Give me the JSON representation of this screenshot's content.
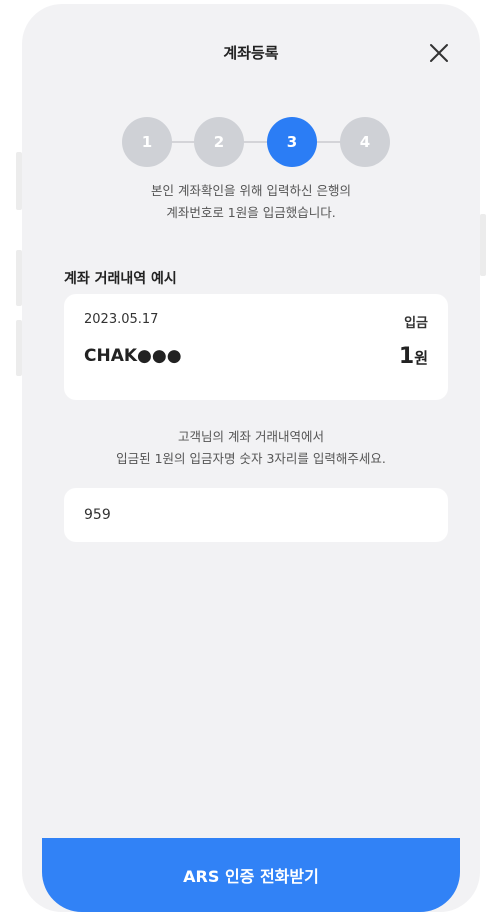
{
  "header": {
    "title": "계좌등록",
    "close_icon": "close-icon"
  },
  "steps": [
    {
      "label": "1",
      "active": false
    },
    {
      "label": "2",
      "active": false
    },
    {
      "label": "3",
      "active": true
    },
    {
      "label": "4",
      "active": false
    }
  ],
  "instruction": {
    "line1": "본인 계좌확인을 위해 입력하신 은행의",
    "line2": "계좌번호로 1원을 입금했습니다."
  },
  "example": {
    "label": "계좌 거래내역 예시",
    "date": "2023.05.17",
    "type": "입금",
    "sender": "CHAK●●●",
    "amount": "1",
    "unit": "원"
  },
  "guide": {
    "line1": "고객님의 계좌 거래내역에서",
    "line2": "입금된 1원의 입금자명 숫자 3자리를 입력해주세요."
  },
  "code_input": {
    "value": "959"
  },
  "cta": {
    "label": "ARS 인증 전화받기"
  },
  "colors": {
    "accent": "#3182f6",
    "step_inactive": "#cfd1d6",
    "background": "#f2f2f4"
  }
}
